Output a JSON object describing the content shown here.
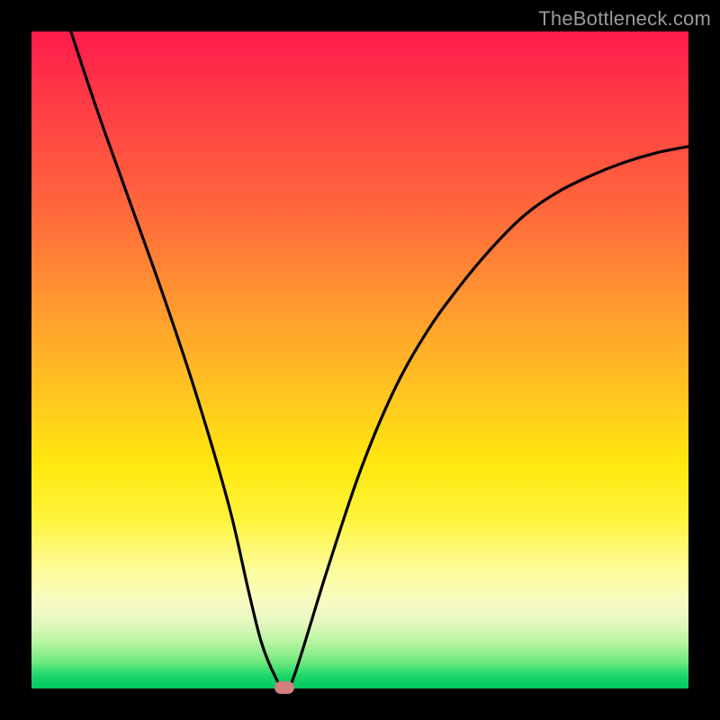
{
  "watermark_text": "TheBottleneck.com",
  "colors": {
    "background": "#000000",
    "gradient_top": "#ff1a4b",
    "gradient_bottom": "#00c85e",
    "curve_stroke": "#000000",
    "marker_fill": "#d47e7e",
    "watermark_color": "#9a9a9a"
  },
  "chart_data": {
    "type": "line",
    "title": "",
    "xlabel": "",
    "ylabel": "",
    "xlim": [
      0,
      100
    ],
    "ylim": [
      0,
      100
    ],
    "description": "V-shaped bottleneck curve over a red-to-green vertical gradient. Y represents bottleneck severity (high at top, zero at bottom). The curve dips to zero at the optimal x position and rises steeply on either side.",
    "series": [
      {
        "name": "bottleneck-curve",
        "x": [
          6,
          10,
          15,
          20,
          25,
          30,
          33,
          35,
          37,
          38.5,
          40,
          45,
          50,
          55,
          60,
          65,
          70,
          75,
          80,
          85,
          90,
          95,
          100
        ],
        "y": [
          100,
          88,
          74,
          60,
          45,
          28,
          15,
          7,
          2,
          0,
          2,
          18,
          33,
          45,
          54,
          61,
          67,
          72,
          75.5,
          78,
          80,
          81.5,
          82.5
        ]
      }
    ],
    "marker": {
      "name": "optimal-point",
      "x": 38.5,
      "y": 0
    },
    "gradient_stops": [
      {
        "pos": 0.0,
        "color": "#ff1a4b"
      },
      {
        "pos": 0.28,
        "color": "#ff6a3b"
      },
      {
        "pos": 0.55,
        "color": "#ffc520"
      },
      {
        "pos": 0.74,
        "color": "#fff43a"
      },
      {
        "pos": 0.9,
        "color": "#e4f8c0"
      },
      {
        "pos": 1.0,
        "color": "#00c85e"
      }
    ]
  }
}
